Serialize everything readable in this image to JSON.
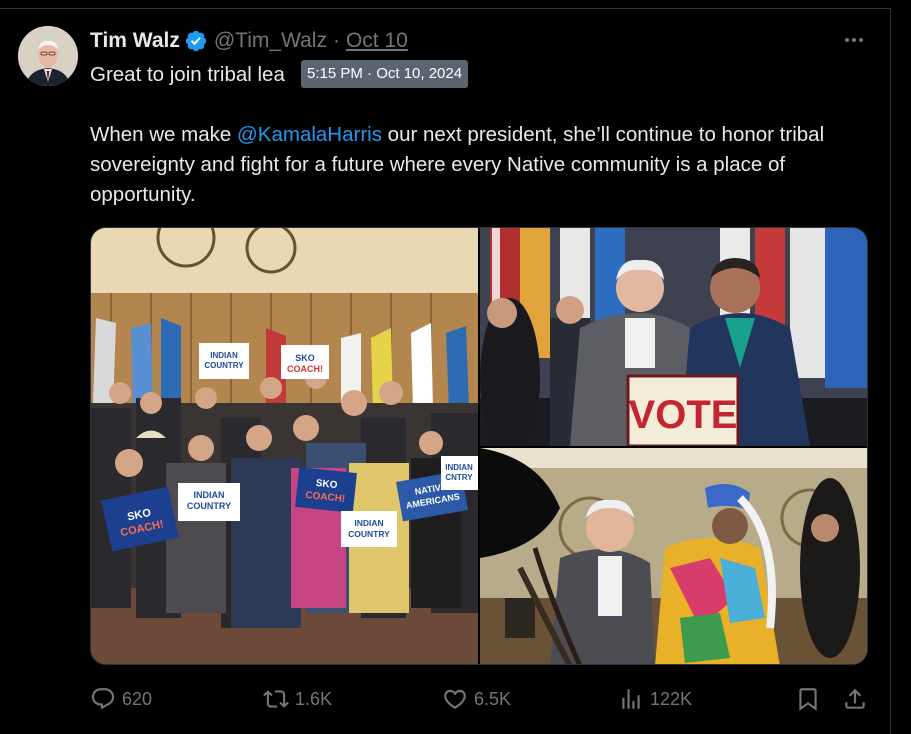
{
  "tweet": {
    "author_name": "Tim Walz",
    "handle": "@Tim_Walz",
    "separator": "·",
    "date": "Oct 10",
    "tooltip": "5:15 PM · Oct 10, 2024",
    "text_line1": "Great to join tribal lea",
    "text_line2_prefix": "When we make ",
    "mention": "@KamalaHarris",
    "text_line2_suffix": " our next president, she’ll continue to honor tribal sovereignty and fight for a future where every Native community is a place of opportunity."
  },
  "photos": {
    "signs": {
      "indian_country": "INDIAN COUNTRY",
      "sko_coach": "SKO COACH!",
      "native_americans": "NATIVE AMERICANS",
      "vote": "VOTE"
    }
  },
  "actions": {
    "replies": "620",
    "reposts": "1.6K",
    "likes": "6.5K",
    "views": "122K"
  },
  "colors": {
    "background": "#000000",
    "accent": "#1d9bf0",
    "muted": "#71767b"
  }
}
